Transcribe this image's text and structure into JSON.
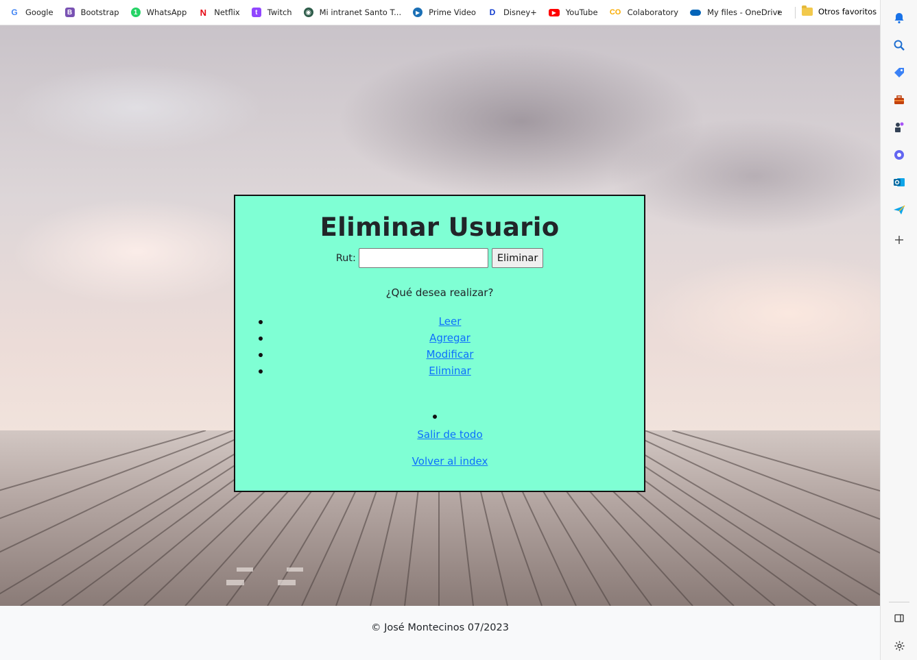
{
  "bookmarks": {
    "items": [
      {
        "label": "Google",
        "icon": "google-icon",
        "color": "#4285f4"
      },
      {
        "label": "Bootstrap",
        "icon": "bootstrap-icon",
        "color": "#7952b3"
      },
      {
        "label": "WhatsApp",
        "icon": "whatsapp-icon",
        "color": "#25d366"
      },
      {
        "label": "Netflix",
        "icon": "netflix-icon",
        "color": "#e50914"
      },
      {
        "label": "Twitch",
        "icon": "twitch-icon",
        "color": "#9146ff"
      },
      {
        "label": "Mi intranet Santo T...",
        "icon": "intranet-icon",
        "color": "#2e5c4a"
      },
      {
        "label": "Prime Video",
        "icon": "prime-video-icon",
        "color": "#1a98ff"
      },
      {
        "label": "Disney+",
        "icon": "disney-icon",
        "color": "#113ccf"
      },
      {
        "label": "YouTube",
        "icon": "youtube-icon",
        "color": "#ff0000"
      },
      {
        "label": "Colaboratory",
        "icon": "colab-icon",
        "color": "#f9ab00"
      },
      {
        "label": "My files - OneDrive",
        "icon": "onedrive-icon",
        "color": "#0364b8"
      }
    ],
    "other_label": "Otros favoritos"
  },
  "panel": {
    "title": "Eliminar Usuario",
    "rut_label": "Rut:",
    "rut_value": "",
    "delete_button": "Eliminar",
    "question": "¿Qué desea realizar?",
    "menu": [
      "Leer",
      "Agregar",
      "Modificar",
      "Eliminar"
    ],
    "exit_link": "Salir de todo",
    "back_link": "Volver al index",
    "background_color": "#7fffd4"
  },
  "footer": {
    "text": "© José Montecinos 07/2023"
  }
}
